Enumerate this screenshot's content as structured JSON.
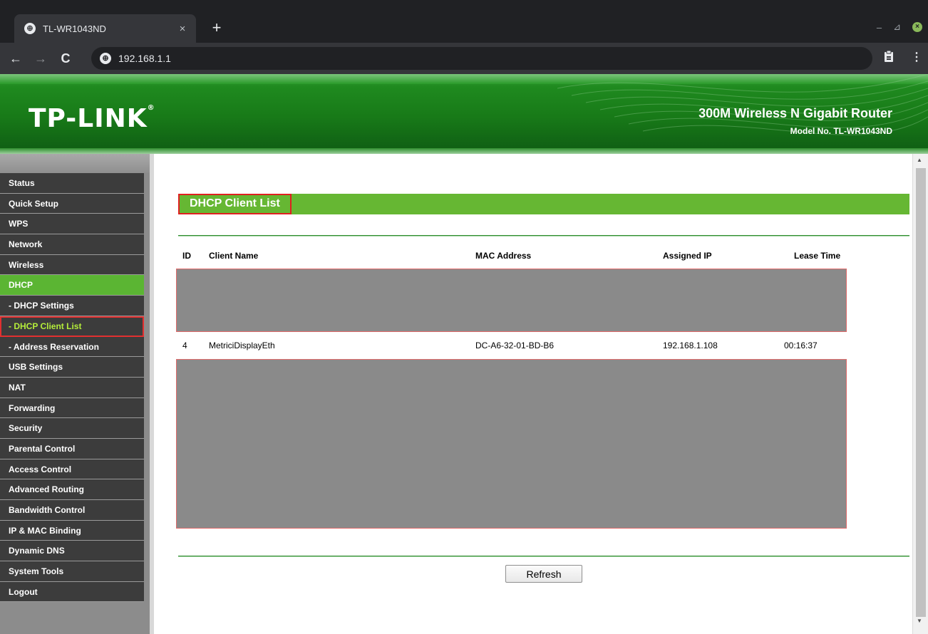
{
  "browser": {
    "tab_title": "TL-WR1043ND",
    "tab_close": "×",
    "new_tab": "+",
    "url": "192.168.1.1",
    "back": "←",
    "forward": "→",
    "reload": "C",
    "profile_icon": "clipboard-icon",
    "menu_icon": "⋮",
    "win_minimize": "–",
    "win_maximize": "⊿",
    "win_close": "×"
  },
  "header": {
    "logo": "TP-LINK",
    "logo_mark": "®",
    "product": "300M Wireless N Gigabit Router",
    "model": "Model No. TL-WR1043ND"
  },
  "sidebar": {
    "items": [
      {
        "label": "Status"
      },
      {
        "label": "Quick Setup"
      },
      {
        "label": "WPS"
      },
      {
        "label": "Network"
      },
      {
        "label": "Wireless"
      },
      {
        "label": "DHCP"
      },
      {
        "label": "- DHCP Settings"
      },
      {
        "label": "- DHCP Client List"
      },
      {
        "label": "- Address Reservation"
      },
      {
        "label": "USB Settings"
      },
      {
        "label": "NAT"
      },
      {
        "label": "Forwarding"
      },
      {
        "label": "Security"
      },
      {
        "label": "Parental Control"
      },
      {
        "label": "Access Control"
      },
      {
        "label": "Advanced Routing"
      },
      {
        "label": "Bandwidth Control"
      },
      {
        "label": "IP & MAC Binding"
      },
      {
        "label": "Dynamic DNS"
      },
      {
        "label": "System Tools"
      },
      {
        "label": "Logout"
      }
    ]
  },
  "main": {
    "title": "DHCP Client List",
    "columns": [
      "ID",
      "Client Name",
      "MAC Address",
      "Assigned IP",
      "Lease Time"
    ],
    "row": {
      "id": "4",
      "client_name": "MetriciDisplayEth",
      "mac": "DC-A6-32-01-BD-B6",
      "ip": "192.168.1.108",
      "lease": "00:16:37"
    },
    "refresh_label": "Refresh"
  }
}
